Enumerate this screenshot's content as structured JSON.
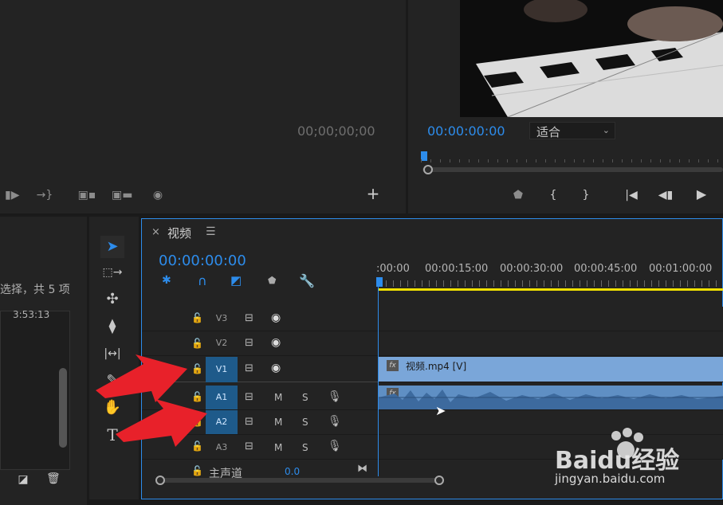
{
  "source_monitor": {
    "timecode": "00;00;00;00"
  },
  "program_monitor": {
    "timecode": "00:00:00:00",
    "fit_select": "适合"
  },
  "project_panel": {
    "selection_text": "选择，共 5 项",
    "duration": "3:53:13"
  },
  "timeline": {
    "tab_title": "视频",
    "timecode": "00:00:00:00",
    "ruler_labels": [
      ":00:00",
      "00:00:15:00",
      "00:00:30:00",
      "00:00:45:00",
      "00:01:00:00"
    ],
    "video_tracks": [
      {
        "name": "V3",
        "on": false
      },
      {
        "name": "V2",
        "on": false
      },
      {
        "name": "V1",
        "on": true
      }
    ],
    "audio_tracks": [
      {
        "name": "A1",
        "on": true
      },
      {
        "name": "A2",
        "on": true
      },
      {
        "name": "A3",
        "on": false
      }
    ],
    "mute_label": "M",
    "solo_label": "S",
    "master_label": "主声道",
    "master_value": "0.0",
    "video_clip_label": "视频.mp4 [V]",
    "fx_label": "fx"
  },
  "watermark": {
    "brand": "Baidu经验",
    "url": "jingyan.baidu.com"
  },
  "colors": {
    "accent": "#2d8ceb",
    "video_clip": "#7aa6d9",
    "audio_clip": "#5f8fc4",
    "work_area": "#f0e000",
    "arrow": "#e8212a"
  }
}
